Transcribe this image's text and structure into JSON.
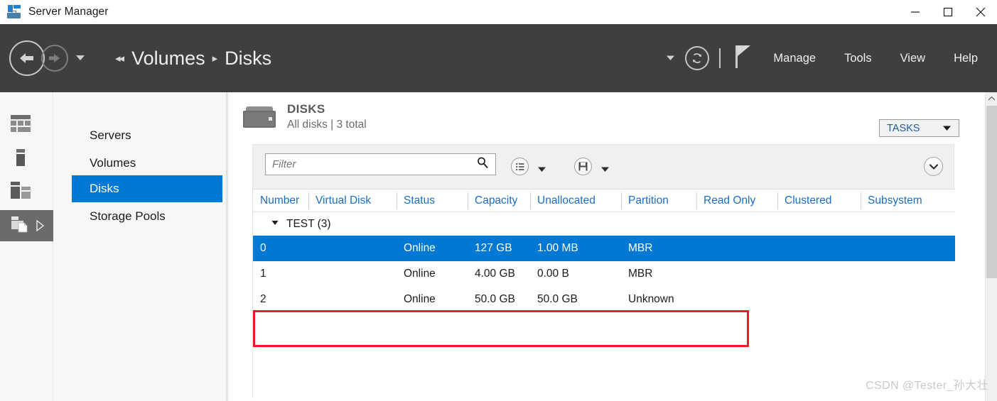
{
  "window": {
    "title": "Server Manager",
    "icon": "server-manager-icon",
    "controls": {
      "minimize": "minimize-icon",
      "maximize": "maximize-icon",
      "close": "close-icon"
    }
  },
  "commandbar": {
    "back": "back-arrow-icon",
    "forward": "forward-arrow-icon",
    "history_dropdown": "caret-down-icon",
    "breadcrumb": {
      "back_chevrons": "◂◂",
      "items": [
        "Volumes",
        "Disks"
      ],
      "separator": "▸"
    },
    "notifications_dropdown": "caret-down-icon",
    "refresh": "refresh-icon",
    "flag": "flag-icon",
    "menu": [
      "Manage",
      "Tools",
      "View",
      "Help"
    ]
  },
  "rail": {
    "items": [
      {
        "name": "dashboard-icon",
        "selected": false
      },
      {
        "name": "local-server-icon",
        "selected": false
      },
      {
        "name": "all-servers-icon",
        "selected": false
      },
      {
        "name": "file-storage-services-icon",
        "selected": true,
        "expand": "▷"
      }
    ]
  },
  "nav": {
    "items": [
      {
        "label": "Servers",
        "active": false
      },
      {
        "label": "Volumes",
        "active": false
      },
      {
        "label": "Disks",
        "active": true
      },
      {
        "label": "Storage Pools",
        "active": false
      }
    ]
  },
  "header": {
    "icon": "disk-icon",
    "title": "DISKS",
    "subtitle": "All disks | 3 total",
    "tasks_label": "TASKS",
    "tasks_caret": "▼"
  },
  "filter": {
    "placeholder": "Filter",
    "value": "",
    "search_icon": "search-icon",
    "list_view_icon": "list-view-icon",
    "list_view_caret": "▼",
    "save_icon": "save-icon",
    "save_caret": "▼",
    "expand_icon": "chevron-down-icon"
  },
  "table": {
    "columns": [
      "Number",
      "Virtual Disk",
      "Status",
      "Capacity",
      "Unallocated",
      "Partition",
      "Read Only",
      "Clustered",
      "Subsystem"
    ],
    "group": {
      "label": "TEST (3)",
      "collapse_icon": "◢"
    },
    "rows": [
      {
        "Number": "0",
        "Virtual Disk": "",
        "Status": "Online",
        "Capacity": "127 GB",
        "Unallocated": "1.00 MB",
        "Partition": "MBR",
        "Read Only": "",
        "Clustered": "",
        "Subsystem": "",
        "selected": true,
        "highlighted": false
      },
      {
        "Number": "1",
        "Virtual Disk": "",
        "Status": "Online",
        "Capacity": "4.00 GB",
        "Unallocated": "0.00 B",
        "Partition": "MBR",
        "Read Only": "",
        "Clustered": "",
        "Subsystem": "",
        "selected": false,
        "highlighted": false
      },
      {
        "Number": "2",
        "Virtual Disk": "",
        "Status": "Online",
        "Capacity": "50.0 GB",
        "Unallocated": "50.0 GB",
        "Partition": "Unknown",
        "Read Only": "",
        "Clustered": "",
        "Subsystem": "",
        "selected": false,
        "highlighted": true
      }
    ]
  },
  "annotation": {
    "color": "#ec1c24",
    "target_row": 2
  },
  "scrollbar": {
    "up_icon": "chevron-up-icon"
  },
  "watermark": "CSDN @Tester_孙大壮",
  "colors": {
    "accent": "#0078d4",
    "command_bar": "#3f3f3f",
    "header_link": "#1b6ec2",
    "annotation_red": "#ec1c24"
  }
}
